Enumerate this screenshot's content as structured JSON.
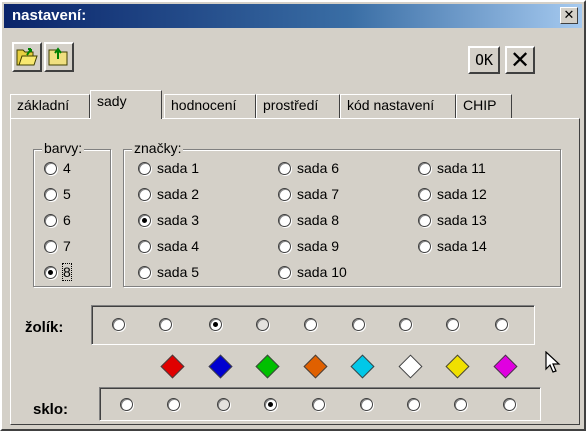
{
  "window": {
    "title": "nastavení:",
    "close_glyph": "✕"
  },
  "toolbar": {
    "open_icon": "folder-open-icon",
    "save_icon": "folder-save-icon",
    "ok_label": "OK",
    "cancel_glyph": "✕"
  },
  "tabs": [
    {
      "label": "základní",
      "active": false
    },
    {
      "label": "sady",
      "active": true
    },
    {
      "label": "hodnocení",
      "active": false
    },
    {
      "label": "prostředí",
      "active": false
    },
    {
      "label": "kód nastavení",
      "active": false
    },
    {
      "label": "CHIP",
      "active": false
    }
  ],
  "barvy": {
    "legend": "barvy:",
    "options": [
      "4",
      "5",
      "6",
      "7",
      "8"
    ],
    "selected": "8"
  },
  "znacky": {
    "legend": "značky:",
    "options": [
      "sada 1",
      "sada 2",
      "sada 3",
      "sada 4",
      "sada 5",
      "sada 6",
      "sada 7",
      "sada 8",
      "sada 9",
      "sada 10",
      "sada 11",
      "sada 12",
      "sada 13",
      "sada 14"
    ],
    "selected": "sada 3"
  },
  "zolik": {
    "label": "žolík:",
    "selected_index": 2
  },
  "colors": [
    "#e00000",
    "#0000d0",
    "#00c000",
    "#e06000",
    "#00c8e8",
    "#ffffff",
    "#f0e000",
    "#e000e0"
  ],
  "sklo": {
    "label": "sklo:",
    "selected_index": 3
  }
}
